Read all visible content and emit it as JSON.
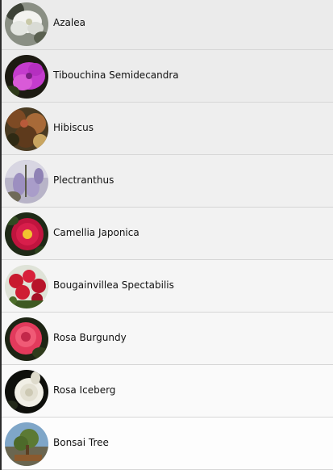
{
  "flowers": {
    "items": [
      {
        "label": "Azalea",
        "image": "white azalea flower photo"
      },
      {
        "label": "Tibouchina Semidecandra",
        "image": "purple tibouchina flower photo"
      },
      {
        "label": "Hibiscus",
        "image": "hibiscus bush photo"
      },
      {
        "label": "Plectranthus",
        "image": "lavender plectranthus photo"
      },
      {
        "label": "Camellia Japonica",
        "image": "red camellia flower photo"
      },
      {
        "label": "Bougainvillea Spectabilis",
        "image": "red bougainvillea photo"
      },
      {
        "label": "Rosa Burgundy",
        "image": "pink rose photo"
      },
      {
        "label": "Rosa Iceberg",
        "image": "white rose photo"
      },
      {
        "label": "Bonsai Tree",
        "image": "bonsai tree photo"
      }
    ]
  }
}
